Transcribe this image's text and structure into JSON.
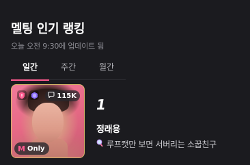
{
  "header": {
    "title": "멜팅 인기 랭킹",
    "updated": "오늘 오전 9:30에 업데이트 됨"
  },
  "tabs": [
    {
      "label": "일간",
      "active": true
    },
    {
      "label": "주간",
      "active": false
    },
    {
      "label": "월간",
      "active": false
    }
  ],
  "ranking": [
    {
      "rank": "1",
      "name": "정래용",
      "description": "루프캣만 보면 서버리는 소꿉친구",
      "description_icon": "magnifier-emoji-icon",
      "count": "115K",
      "count_icon": "chat-bubble-icon",
      "badge_icons": [
        "shield-icon",
        "hexagon-icon"
      ],
      "only_label": "Only",
      "only_icon": "m-logo-icon"
    }
  ],
  "colors": {
    "background": "#1b1b1f",
    "accent": "#ff5a8f",
    "card_border": "#d8b66a"
  }
}
